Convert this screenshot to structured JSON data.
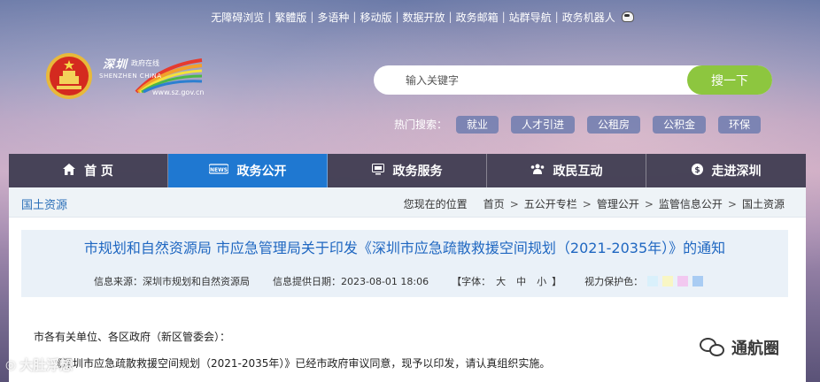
{
  "topbar": {
    "links": [
      "无障碍浏览",
      "繁體版",
      "多语种",
      "移动版",
      "数据开放",
      "政务邮箱",
      "站群导航",
      "政务机器人"
    ]
  },
  "logo": {
    "cn_name": "深圳",
    "cn_sub": "政府在线",
    "en_name": "SHENZHEN CHINA",
    "url": "www.sz.gov.cn"
  },
  "search": {
    "placeholder": "输入关键字",
    "button_label": "搜一下"
  },
  "hot_search": {
    "label": "热门搜索：",
    "tags": [
      "就业",
      "人才引进",
      "公租房",
      "公积金",
      "环保"
    ]
  },
  "nav": {
    "items": [
      {
        "label": "首 页",
        "icon": "home-icon",
        "active": false
      },
      {
        "label": "政务公开",
        "icon": "news-icon",
        "active": true
      },
      {
        "label": "政务服务",
        "icon": "monitor-icon",
        "active": false
      },
      {
        "label": "政民互动",
        "icon": "people-icon",
        "active": false
      },
      {
        "label": "走进深圳",
        "icon": "dollar-icon",
        "active": false
      }
    ]
  },
  "crumb": {
    "section": "国土资源",
    "here_label": "您现在的位置",
    "path": [
      "首页",
      "五公开专栏",
      "管理公开",
      "监管信息公开",
      "国土资源"
    ]
  },
  "article": {
    "title": "市规划和自然资源局 市应急管理局关于印发《深圳市应急疏散救援空间规划（2021-2035年）》的通知",
    "source": "信息来源：深圳市规划和自然资源局",
    "date": "信息提供日期：2023-08-01 18:06",
    "font_label": "【字体：",
    "font_sizes": [
      "大",
      "中",
      "小"
    ],
    "font_close": "】",
    "eye_label": "视力保护色：",
    "eye_colors": [
      "#d9f0fb",
      "#f8f6c4",
      "#f2c8f0",
      "#a9ccf3"
    ],
    "salutation": "市各有关单位、各区政府（新区管委会）：",
    "line2": "《深圳市应急疏散救援空间规划（2021-2035年）》已经市政府审议同意，现予以印发，请认真组织实施。"
  },
  "watermarks": {
    "left": "大肚浮想",
    "right": "通航圈"
  },
  "colors": {
    "accent_blue": "#1f78d1",
    "search_green": "#8dc63f",
    "title_blue": "#1f67c1"
  }
}
